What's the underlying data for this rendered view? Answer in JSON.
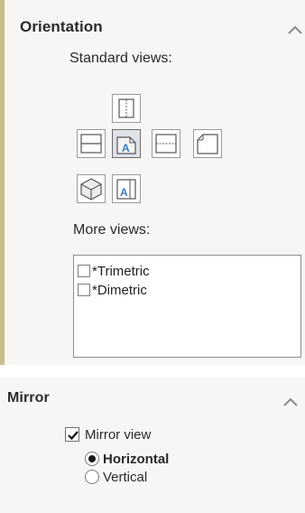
{
  "orientation": {
    "title": "Orientation",
    "standard_views_label": "Standard views:",
    "more_views_label": "More views:",
    "more_views": [
      {
        "label": "*Trimetric",
        "checked": false
      },
      {
        "label": "*Dimetric",
        "checked": false
      }
    ],
    "selected_view": "front"
  },
  "mirror": {
    "title": "Mirror",
    "mirror_view_label": "Mirror view",
    "mirror_view_checked": true,
    "options": [
      {
        "label": "Horizontal",
        "selected": true
      },
      {
        "label": "Vertical",
        "selected": false
      }
    ]
  },
  "icons": {
    "top": "top-view-icon",
    "bottom": "bottom-view-icon",
    "left": "left-view-icon",
    "front": "front-view-icon",
    "right": "right-view-icon",
    "back": "back-view-icon",
    "isometric": "isometric-view-icon",
    "normal_to": "normal-to-view-icon",
    "collapse": "chevron-up-icon"
  },
  "colors": {
    "panel_bg": "#f7f6f4",
    "accent_bar": "#c9bf8b",
    "view_face": "#4a86c6"
  }
}
